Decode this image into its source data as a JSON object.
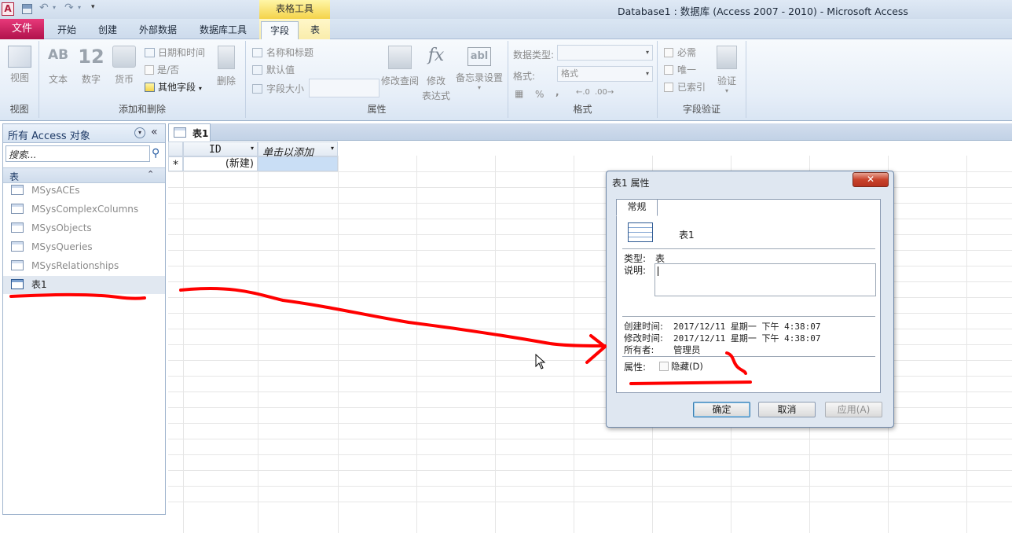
{
  "window": {
    "title": "Database1 : 数据库 (Access 2007 - 2010)  -  Microsoft Access",
    "app_icon": "A"
  },
  "ribbon_tabs": {
    "file": "文件",
    "home": "开始",
    "create": "创建",
    "external": "外部数据",
    "dbtools": "数据库工具",
    "fields": "字段",
    "table": "表",
    "context_label": "表格工具"
  },
  "ribbon": {
    "view": {
      "label": "视图",
      "group": "视图"
    },
    "add_delete": {
      "text": "文本",
      "number": "数字",
      "currency": "货币",
      "datetime": "日期和时间",
      "yesno": "是/否",
      "more": "其他字段",
      "delete": "删除",
      "group": "添加和删除",
      "ab": "AB",
      "n12": "12"
    },
    "properties": {
      "name_caption": "名称和标题",
      "default": "默认值",
      "field_size": "字段大小",
      "modify_lookup": "修改查阅",
      "modify": "修改",
      "expression": "表达式",
      "memo": "备忘录设置",
      "group": "属性",
      "fx": "fx",
      "abl": "abl"
    },
    "formatting": {
      "datatype_label": "数据类型:",
      "format_label": "格式:",
      "format_value": "格式",
      "group": "格式",
      "percent": "%",
      "comma": ","
    },
    "validation": {
      "required": "必需",
      "unique": "唯一",
      "indexed": "已索引",
      "validate": "验证",
      "group": "字段验证"
    }
  },
  "nav": {
    "header": "所有 Access 对象",
    "search_placeholder": "搜索...",
    "section": "表",
    "items": [
      "MSysACEs",
      "MSysComplexColumns",
      "MSysObjects",
      "MSysQueries",
      "MSysRelationships",
      "表1"
    ]
  },
  "doc": {
    "tab": "表1",
    "col_id": "ID",
    "col_add": "单击以添加",
    "new_row": "(新建)",
    "new_marker": "*"
  },
  "dialog": {
    "title": "表1 属性",
    "tab": "常规",
    "name": "表1",
    "type_label": "类型:",
    "type_value": "表",
    "desc_label": "说明:",
    "created_label": "创建时间:",
    "created_value": "2017/12/11 星期一 下午 4:38:07",
    "modified_label": "修改时间:",
    "modified_value": "2017/12/11 星期一 下午 4:38:07",
    "owner_label": "所有者:",
    "owner_value": "管理员",
    "attr_label": "属性:",
    "hidden_label": "隐藏(D)",
    "ok": "确定",
    "cancel": "取消",
    "apply": "应用(A)"
  },
  "colors": {
    "file_tab": "#c8175e",
    "context_tab": "#f6d64c",
    "annotation": "#ff0000",
    "selection": "#c9def5"
  }
}
